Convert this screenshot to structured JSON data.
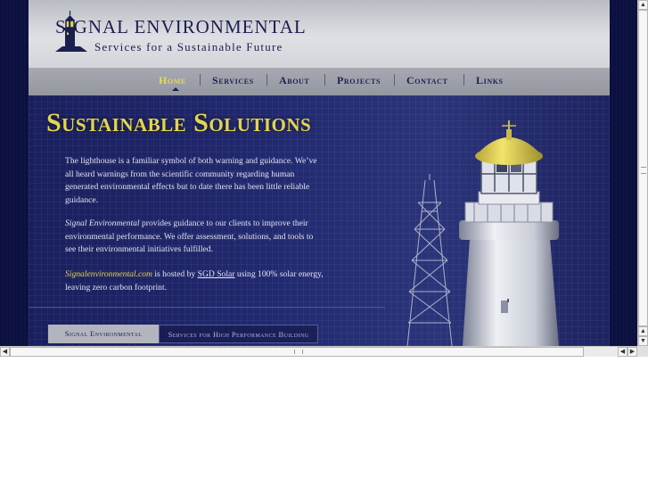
{
  "brand": {
    "title": "SIGNAL ENVIRONMENTAL",
    "tagline": "Services for a Sustainable Future"
  },
  "nav": {
    "items": [
      {
        "label": "Home",
        "active": true
      },
      {
        "label": "Services",
        "active": false
      },
      {
        "label": "About",
        "active": false
      },
      {
        "label": "Projects",
        "active": false
      },
      {
        "label": "Contact",
        "active": false
      },
      {
        "label": "Links",
        "active": false
      }
    ]
  },
  "main": {
    "headline": "Sustainable Solutions",
    "paragraph1": "The lighthouse is a familiar symbol of both warning and guidance. We’ve all heard warnings from the scientific community regarding human generated environmental effects but to date there has been little reliable guidance.",
    "paragraph2_em": "Signal Environmental",
    "paragraph2_rest": " provides guidance to our clients to improve their environmental performance. We offer assessment, solutions, and tools to see their environmental initiatives fulfilled.",
    "paragraph3_site": "Signalenvironmental.com",
    "paragraph3_mid": " is hosted by ",
    "paragraph3_link": "SGD Solar",
    "paragraph3_rest": " using 100% solar energy, leaving zero carbon footprint."
  },
  "tabs": {
    "signal": "Signal Environmental",
    "services": "Services for High Performance Building"
  },
  "colors": {
    "accent_yellow": "#e4d64a",
    "navy": "#1c2052",
    "panel": "#222a70"
  }
}
